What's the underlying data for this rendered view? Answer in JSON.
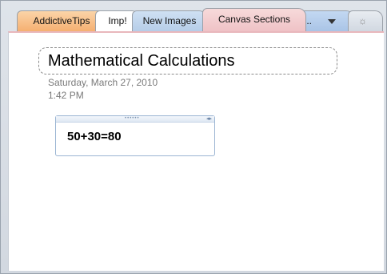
{
  "tabs": [
    {
      "label": "AddictiveTips"
    },
    {
      "label": "Imp!"
    },
    {
      "label": "New Images"
    },
    {
      "label": "Canvas Sections"
    }
  ],
  "more_tabs": {
    "label": "..."
  },
  "new_section": {
    "label": "☼"
  },
  "page": {
    "title": "Mathematical Calculations",
    "date": "Saturday, March 27, 2010",
    "time": "1:42 PM"
  },
  "note": {
    "text": "50+30=80"
  },
  "colors": {
    "active_tab": "#efc2c6",
    "tab_addictive": "#f5b071",
    "tab_new_images": "#b6cde8"
  }
}
